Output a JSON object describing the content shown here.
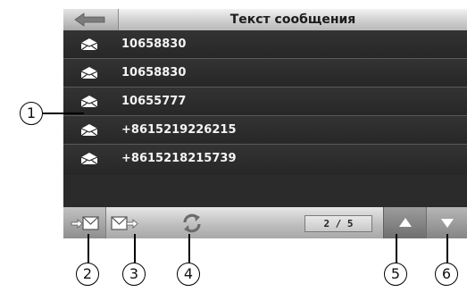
{
  "header": {
    "title": "Текст сообщения",
    "back_icon": "back-arrow-icon"
  },
  "messages": [
    {
      "icon": "envelope-icon",
      "number": "10658830"
    },
    {
      "icon": "envelope-icon",
      "number": "10658830"
    },
    {
      "icon": "envelope-icon",
      "number": "10655777"
    },
    {
      "icon": "envelope-icon",
      "number": "+8615219226215"
    },
    {
      "icon": "envelope-icon",
      "number": "+8615218215739"
    }
  ],
  "toolbar": {
    "inbox_icon": "inbox-icon",
    "outbox_icon": "outbox-icon",
    "refresh_icon": "refresh-icon",
    "page_indicator": "2 / 5",
    "up_icon": "up-arrow-icon",
    "down_icon": "down-arrow-icon"
  },
  "callouts": [
    "1",
    "2",
    "3",
    "4",
    "5",
    "6"
  ]
}
